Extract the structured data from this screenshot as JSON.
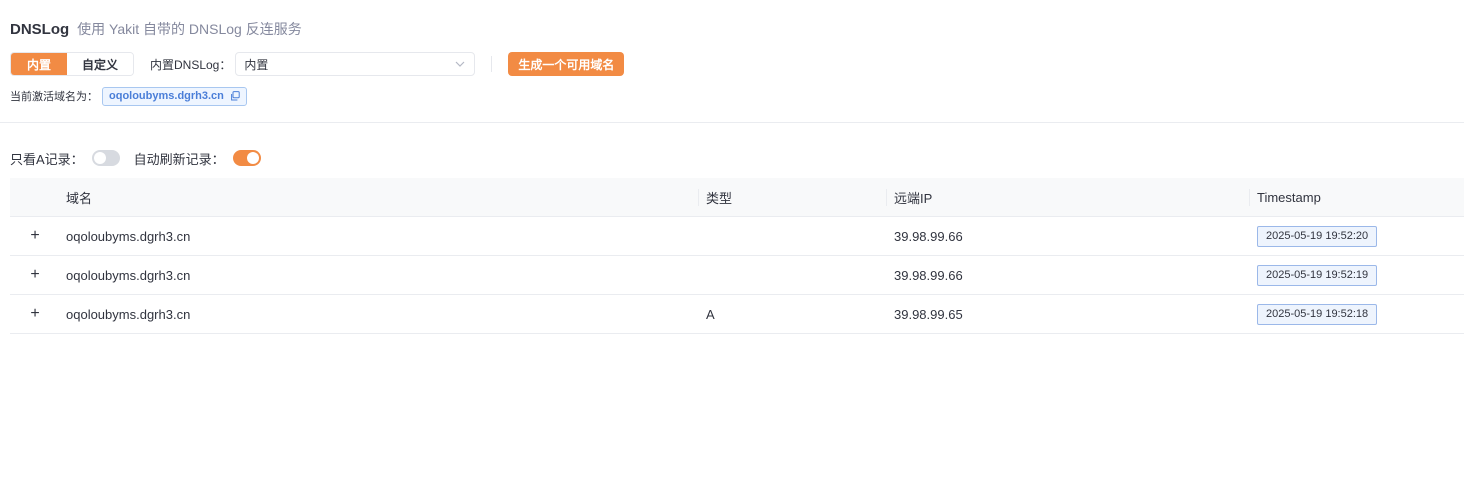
{
  "header": {
    "title": "DNSLog",
    "subtitle": "使用 Yakit 自带的 DNSLog 反连服务"
  },
  "controls": {
    "mode_builtin": "内置",
    "mode_custom": "自定义",
    "select_label": "内置DNSLog：",
    "select_value": "内置",
    "generate_button": "生成一个可用域名"
  },
  "domain": {
    "label": "当前激活域名为：",
    "value": "oqoloubyms.dgrh3.cn"
  },
  "filters": {
    "only_a_label": "只看A记录：",
    "only_a_on": false,
    "auto_refresh_label": "自动刷新记录：",
    "auto_refresh_on": true
  },
  "table": {
    "columns": [
      "域名",
      "类型",
      "远端IP",
      "Timestamp"
    ],
    "rows": [
      {
        "expand": "+",
        "domain": "oqoloubyms.dgrh3.cn",
        "type": "",
        "ip": "39.98.99.66",
        "timestamp": "2025-05-19 19:52:20"
      },
      {
        "expand": "+",
        "domain": "oqoloubyms.dgrh3.cn",
        "type": "",
        "ip": "39.98.99.66",
        "timestamp": "2025-05-19 19:52:19"
      },
      {
        "expand": "+",
        "domain": "oqoloubyms.dgrh3.cn",
        "type": "A",
        "ip": "39.98.99.65",
        "timestamp": "2025-05-19 19:52:18"
      }
    ]
  },
  "colors": {
    "accent": "#f28b44",
    "tag_blue": "#4a7ed8",
    "text": "#31343f",
    "muted": "#85899e"
  }
}
